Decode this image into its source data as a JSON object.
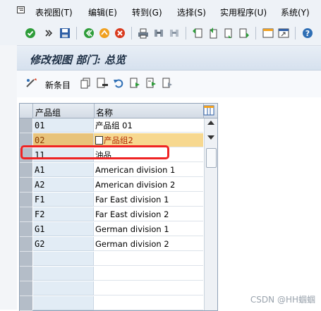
{
  "menu": {
    "items": [
      "表视图(T)",
      "编辑(E)",
      "转到(G)",
      "选择(S)",
      "实用程序(U)",
      "系统(Y)"
    ]
  },
  "page": {
    "title": "修改视图 部门: 总览"
  },
  "appbar": {
    "new_entries_label": "新条目"
  },
  "table": {
    "columns": [
      "产品组",
      "名称"
    ],
    "rows": [
      {
        "code": "01",
        "name": "产品组 01"
      },
      {
        "code": "02",
        "name": "产品组2"
      },
      {
        "code": "11",
        "name": "油品"
      },
      {
        "code": "A1",
        "name": "American division 1"
      },
      {
        "code": "A2",
        "name": "American division 2"
      },
      {
        "code": "F1",
        "name": "Far East division 1"
      },
      {
        "code": "F2",
        "name": "Far East division 2"
      },
      {
        "code": "G1",
        "name": "German division 1"
      },
      {
        "code": "G2",
        "name": "German division 2"
      }
    ]
  },
  "watermark": "CSDN @HH蝈蝈",
  "colors": {
    "accent": "#1d2f45",
    "highlight_row": "#f7d88f",
    "annotation_red": "#ef2323"
  }
}
